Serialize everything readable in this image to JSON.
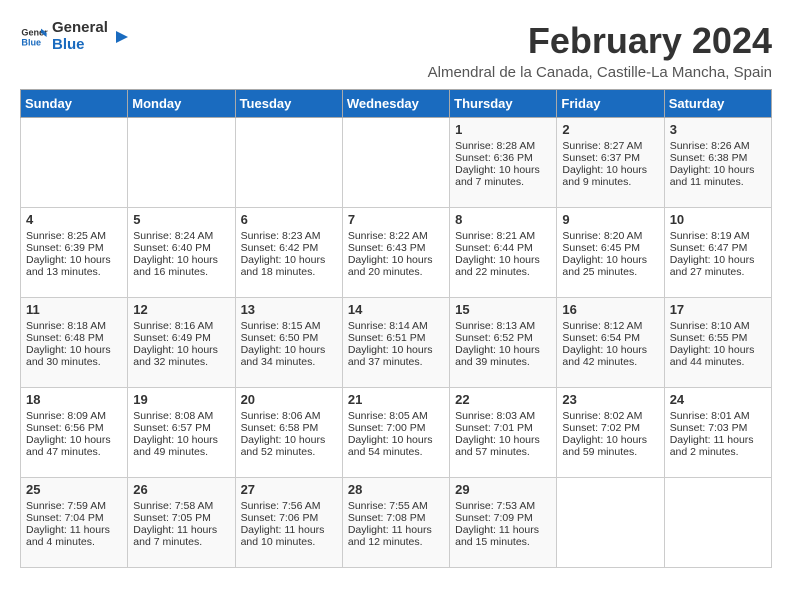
{
  "logo": {
    "line1": "General",
    "line2": "Blue"
  },
  "title": "February 2024",
  "subtitle": "Almendral de la Canada, Castille-La Mancha, Spain",
  "days_of_week": [
    "Sunday",
    "Monday",
    "Tuesday",
    "Wednesday",
    "Thursday",
    "Friday",
    "Saturday"
  ],
  "weeks": [
    [
      {
        "day": "",
        "info": ""
      },
      {
        "day": "",
        "info": ""
      },
      {
        "day": "",
        "info": ""
      },
      {
        "day": "",
        "info": ""
      },
      {
        "day": "1",
        "info": "Sunrise: 8:28 AM\nSunset: 6:36 PM\nDaylight: 10 hours\nand 7 minutes."
      },
      {
        "day": "2",
        "info": "Sunrise: 8:27 AM\nSunset: 6:37 PM\nDaylight: 10 hours\nand 9 minutes."
      },
      {
        "day": "3",
        "info": "Sunrise: 8:26 AM\nSunset: 6:38 PM\nDaylight: 10 hours\nand 11 minutes."
      }
    ],
    [
      {
        "day": "4",
        "info": "Sunrise: 8:25 AM\nSunset: 6:39 PM\nDaylight: 10 hours\nand 13 minutes."
      },
      {
        "day": "5",
        "info": "Sunrise: 8:24 AM\nSunset: 6:40 PM\nDaylight: 10 hours\nand 16 minutes."
      },
      {
        "day": "6",
        "info": "Sunrise: 8:23 AM\nSunset: 6:42 PM\nDaylight: 10 hours\nand 18 minutes."
      },
      {
        "day": "7",
        "info": "Sunrise: 8:22 AM\nSunset: 6:43 PM\nDaylight: 10 hours\nand 20 minutes."
      },
      {
        "day": "8",
        "info": "Sunrise: 8:21 AM\nSunset: 6:44 PM\nDaylight: 10 hours\nand 22 minutes."
      },
      {
        "day": "9",
        "info": "Sunrise: 8:20 AM\nSunset: 6:45 PM\nDaylight: 10 hours\nand 25 minutes."
      },
      {
        "day": "10",
        "info": "Sunrise: 8:19 AM\nSunset: 6:47 PM\nDaylight: 10 hours\nand 27 minutes."
      }
    ],
    [
      {
        "day": "11",
        "info": "Sunrise: 8:18 AM\nSunset: 6:48 PM\nDaylight: 10 hours\nand 30 minutes."
      },
      {
        "day": "12",
        "info": "Sunrise: 8:16 AM\nSunset: 6:49 PM\nDaylight: 10 hours\nand 32 minutes."
      },
      {
        "day": "13",
        "info": "Sunrise: 8:15 AM\nSunset: 6:50 PM\nDaylight: 10 hours\nand 34 minutes."
      },
      {
        "day": "14",
        "info": "Sunrise: 8:14 AM\nSunset: 6:51 PM\nDaylight: 10 hours\nand 37 minutes."
      },
      {
        "day": "15",
        "info": "Sunrise: 8:13 AM\nSunset: 6:52 PM\nDaylight: 10 hours\nand 39 minutes."
      },
      {
        "day": "16",
        "info": "Sunrise: 8:12 AM\nSunset: 6:54 PM\nDaylight: 10 hours\nand 42 minutes."
      },
      {
        "day": "17",
        "info": "Sunrise: 8:10 AM\nSunset: 6:55 PM\nDaylight: 10 hours\nand 44 minutes."
      }
    ],
    [
      {
        "day": "18",
        "info": "Sunrise: 8:09 AM\nSunset: 6:56 PM\nDaylight: 10 hours\nand 47 minutes."
      },
      {
        "day": "19",
        "info": "Sunrise: 8:08 AM\nSunset: 6:57 PM\nDaylight: 10 hours\nand 49 minutes."
      },
      {
        "day": "20",
        "info": "Sunrise: 8:06 AM\nSunset: 6:58 PM\nDaylight: 10 hours\nand 52 minutes."
      },
      {
        "day": "21",
        "info": "Sunrise: 8:05 AM\nSunset: 7:00 PM\nDaylight: 10 hours\nand 54 minutes."
      },
      {
        "day": "22",
        "info": "Sunrise: 8:03 AM\nSunset: 7:01 PM\nDaylight: 10 hours\nand 57 minutes."
      },
      {
        "day": "23",
        "info": "Sunrise: 8:02 AM\nSunset: 7:02 PM\nDaylight: 10 hours\nand 59 minutes."
      },
      {
        "day": "24",
        "info": "Sunrise: 8:01 AM\nSunset: 7:03 PM\nDaylight: 11 hours\nand 2 minutes."
      }
    ],
    [
      {
        "day": "25",
        "info": "Sunrise: 7:59 AM\nSunset: 7:04 PM\nDaylight: 11 hours\nand 4 minutes."
      },
      {
        "day": "26",
        "info": "Sunrise: 7:58 AM\nSunset: 7:05 PM\nDaylight: 11 hours\nand 7 minutes."
      },
      {
        "day": "27",
        "info": "Sunrise: 7:56 AM\nSunset: 7:06 PM\nDaylight: 11 hours\nand 10 minutes."
      },
      {
        "day": "28",
        "info": "Sunrise: 7:55 AM\nSunset: 7:08 PM\nDaylight: 11 hours\nand 12 minutes."
      },
      {
        "day": "29",
        "info": "Sunrise: 7:53 AM\nSunset: 7:09 PM\nDaylight: 11 hours\nand 15 minutes."
      },
      {
        "day": "",
        "info": ""
      },
      {
        "day": "",
        "info": ""
      }
    ]
  ]
}
